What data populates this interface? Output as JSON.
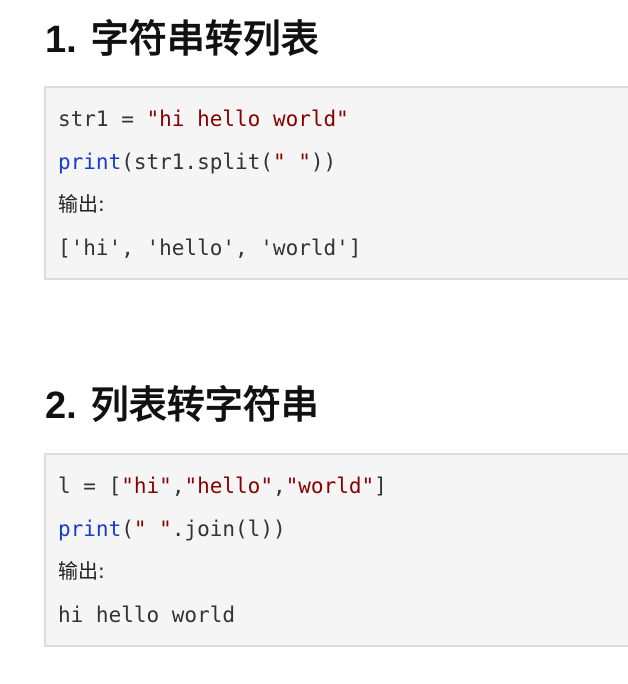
{
  "sections": [
    {
      "number": "1.",
      "title": "字符串转列表",
      "code": {
        "line1": {
          "var": "str1",
          "op": " = ",
          "literal": "\"hi hello world\""
        },
        "line2": {
          "func": "print",
          "open": "(str1.split(",
          "literal": "\" \"",
          "close": "))"
        },
        "output_label": "输出:",
        "output": "['hi', 'hello', 'world']"
      }
    },
    {
      "number": "2.",
      "title": "列表转字符串",
      "code": {
        "line1": {
          "var": "l",
          "op": " = [",
          "items": [
            "\"hi\"",
            "\"hello\"",
            "\"world\""
          ],
          "sep": ",",
          "close": "]"
        },
        "line2": {
          "func": "print",
          "open": "(",
          "literal": "\" \"",
          "close": ".join(l))"
        },
        "output_label": "输出:",
        "output": "hi hello world"
      }
    }
  ],
  "colors": {
    "string": "#880000",
    "keyword": "#1a3cc8",
    "code_background": "#f5f5f5",
    "code_border": "#dcdcdc"
  }
}
